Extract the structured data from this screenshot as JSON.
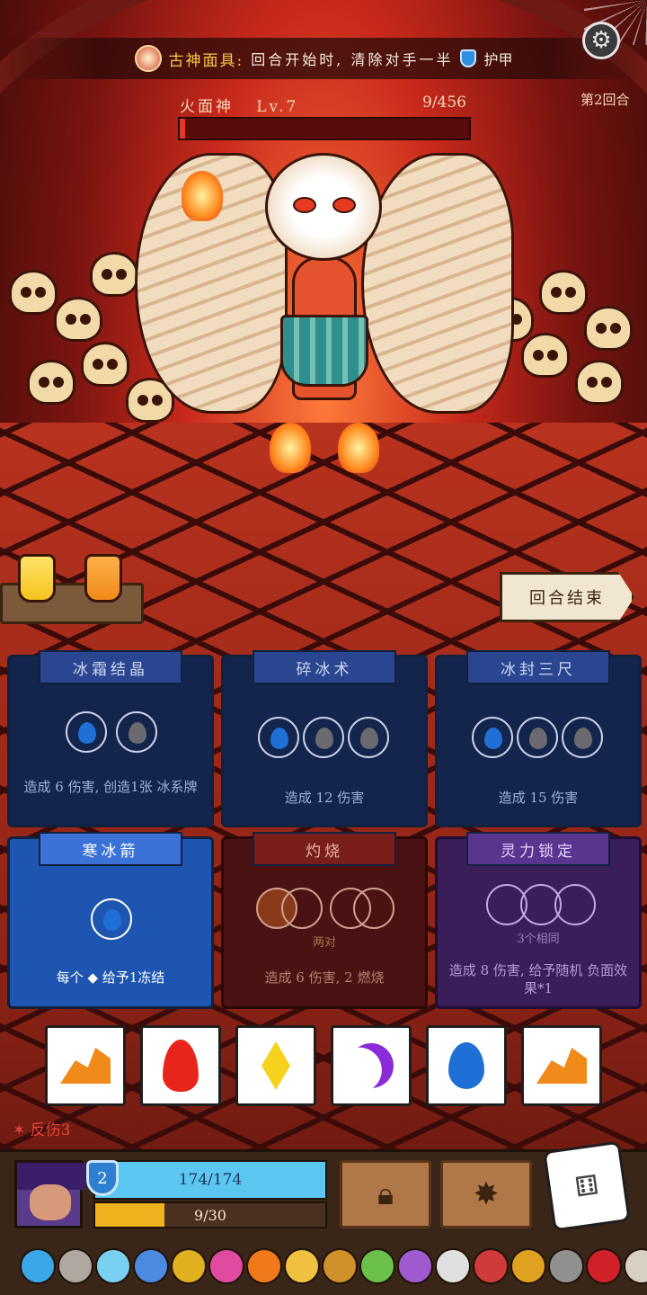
{
  "relic": {
    "name": "古神面具:",
    "desc": "回合开始时, 清除对手一半",
    "armor_word": "护甲"
  },
  "boss": {
    "name": "火面神",
    "level": "Lv.7",
    "hp_text": "9/456",
    "hp_fraction": 0.02
  },
  "round": "第2回合",
  "end_turn": "回合结束",
  "cards": [
    {
      "title": "冰霜结晶",
      "desc": "造成 6 伤害, 创造1张 冰系牌"
    },
    {
      "title": "碎冰术",
      "desc": "造成 12 伤害"
    },
    {
      "title": "冰封三尺",
      "desc": "造成 15 伤害"
    },
    {
      "title": "寒冰箭",
      "desc": "每个 ◆ 给予1冻结"
    },
    {
      "title": "灼烧",
      "note": "两对",
      "desc": "造成 6 伤害, 2 燃烧"
    },
    {
      "title": "灵力锁定",
      "note": "3个相同",
      "desc": "造成 8 伤害, 给予随机 负面效果*1"
    }
  ],
  "dice": [
    "rock",
    "fire",
    "gem",
    "moon",
    "water",
    "rock"
  ],
  "status": {
    "bleed": "反伤3"
  },
  "player": {
    "level": "2",
    "hp_text": "174/174",
    "xp_text": "9/30",
    "xp_fraction": 0.3
  },
  "colors": {
    "accent": "#f7c94a",
    "hp": "#5cc6f2",
    "xp": "#f0b21e",
    "boss_hp": "#e5382a"
  },
  "icons": {
    "settings": "gear-icon",
    "lock_skill": "padlock-sword-icon",
    "burst_skill": "explosion-icon",
    "roll": "dice-icon"
  }
}
